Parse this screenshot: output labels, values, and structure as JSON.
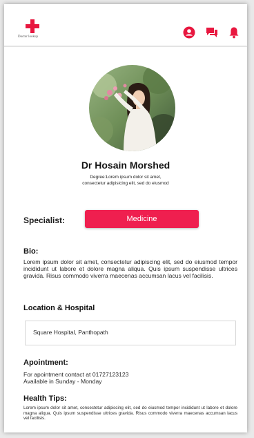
{
  "header": {
    "logo_text": "Doctor lookup",
    "icons": [
      "account-icon",
      "chat-icon",
      "bell-icon"
    ],
    "accent_color": "#e8173f"
  },
  "profile": {
    "name": "Dr Hosain Morshed",
    "degree_line1": "Degree:Lorem ipsum dolor sit amet,",
    "degree_line2": "consectetur adipisicing elit, sed do eiusmod"
  },
  "specialist": {
    "label": "Specialist:",
    "value": "Medicine",
    "button_color": "#ef1f4f"
  },
  "bio": {
    "title": "Bio:",
    "text": "Lorem ipsum dolor sit amet, consectetur adipiscing elit, sed do eiusmod tempor incididunt ut labore et dolore magna aliqua. Quis ipsum suspendisse ultrices gravida. Risus commodo viverra maecenas accumsan lacus vel facilisis."
  },
  "location": {
    "title": "Location & Hospital",
    "value": "Square Hospital, Panthopath"
  },
  "appointment": {
    "title": "Apointment:",
    "line1": "For apointment contact at 01727123123",
    "line2": "Available in Sunday - Monday"
  },
  "health_tips": {
    "title": "Health Tips:",
    "text": "Lorem ipsum dolor sit amet, consectetur adipiscing elit, sed do eiusmod tempor incididunt ut labore et dolore magna aliqua. Quis ipsum suspendisse ultrices gravida. Risus commodo viverra maecenas accumsan lacus vel facilisis."
  }
}
